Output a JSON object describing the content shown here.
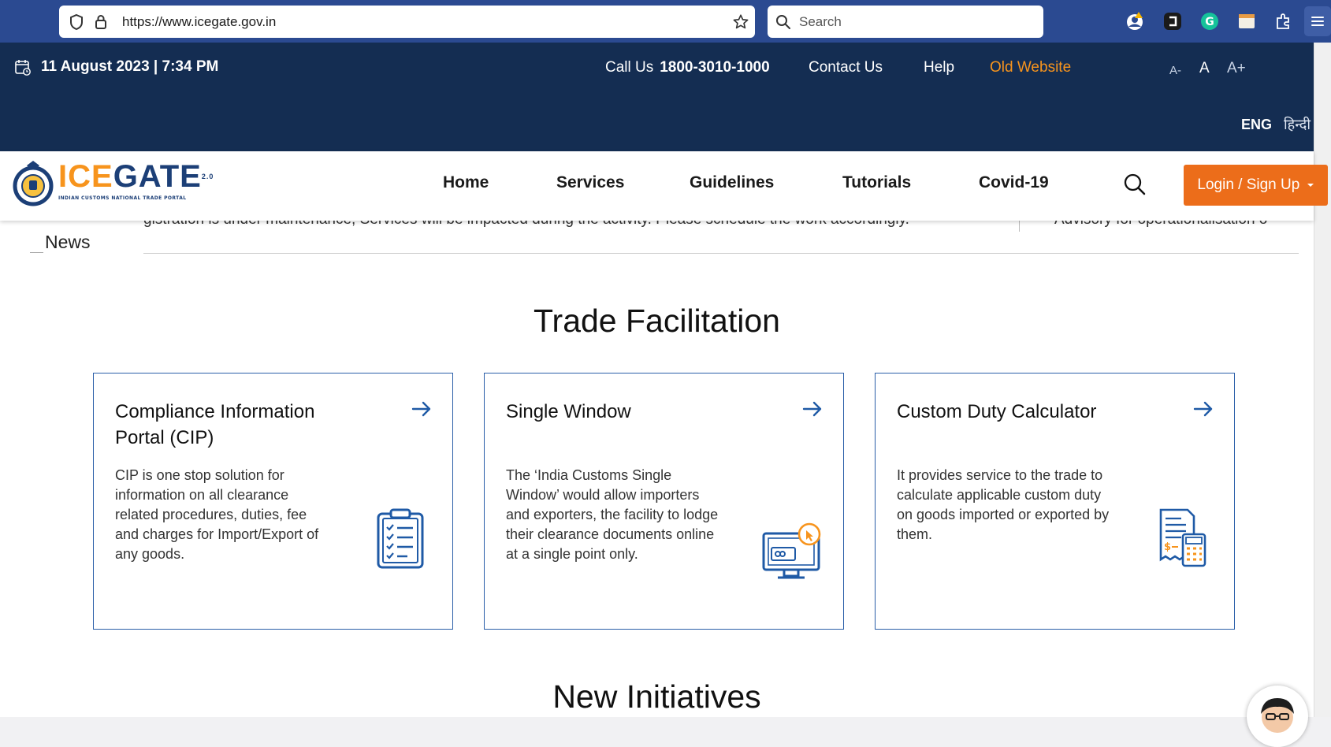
{
  "browser": {
    "url": "https://www.icegate.gov.in",
    "search_placeholder": "Search"
  },
  "topbar": {
    "datetime": "11 August 2023 | 7:34 PM",
    "call_label": "Call Us",
    "call_number": "1800-3010-1000",
    "contact": "Contact Us",
    "help": "Help",
    "old_website": "Old Website",
    "font_small": "A-",
    "font_normal": "A",
    "font_large": "A+",
    "lang_eng": "ENG",
    "lang_hindi": "हिन्दी"
  },
  "logo": {
    "word_part1": "ICE",
    "word_part2": "GATE",
    "version": "2.0",
    "tagline": "INDIAN CUSTOMS NATIONAL TRADE PORTAL"
  },
  "nav": {
    "items": [
      "Home",
      "Services",
      "Guidelines",
      "Tutorials",
      "Covid-19"
    ],
    "login": "Login / Sign Up"
  },
  "news": {
    "label": "News",
    "ticker": [
      "gistration is under maintenance, Services will be impacted during the activity. Please schedule the work accordingly.",
      "Advisory for operationalisation o"
    ]
  },
  "trade": {
    "title": "Trade Facilitation",
    "cards": [
      {
        "title": "Compliance Information Portal (CIP)",
        "desc": "CIP is one stop solution for information on all clearance related procedures, duties, fee and charges for Import/Export of any goods."
      },
      {
        "title": "Single Window",
        "desc": "The ‘India Customs Single Window’ would allow importers and exporters, the facility to lodge their clearance documents online at a single point only."
      },
      {
        "title": "Custom Duty Calculator",
        "desc": "It provides service to the trade to calculate applicable custom duty on goods imported or exported by them."
      }
    ]
  },
  "initiatives": {
    "title": "New Initiatives"
  },
  "colors": {
    "browser_bar": "#2b4a91",
    "header_navy": "#142d52",
    "accent_orange": "#ec6d1a",
    "card_border": "#2a5ea8"
  }
}
